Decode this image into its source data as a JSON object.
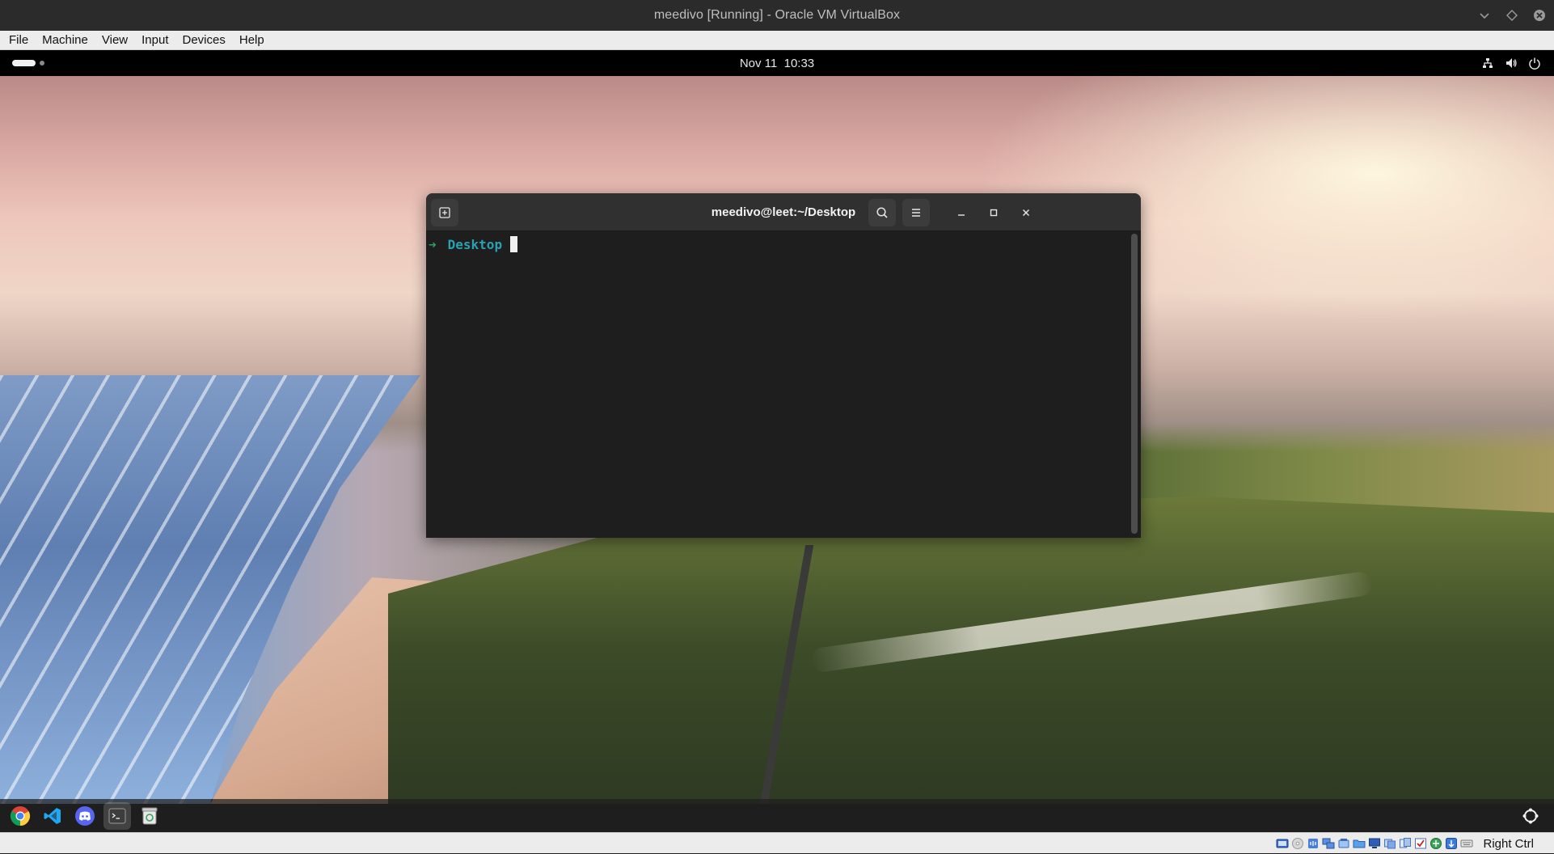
{
  "host_window": {
    "title": "meedivo [Running] - Oracle VM VirtualBox",
    "menu": [
      "File",
      "Machine",
      "View",
      "Input",
      "Devices",
      "Help"
    ],
    "statusbar": {
      "host_key": "Right Ctrl",
      "indicator_icons": [
        "hard-disk-icon",
        "optical-drive-icon",
        "audio-icon",
        "network-icon",
        "usb-icon",
        "shared-folders-icon",
        "display-icon",
        "video-capture-icon",
        "clipboard-icon",
        "drag-drop-icon",
        "cpu-icon",
        "mouse-integration-icon",
        "keyboard-icon"
      ]
    }
  },
  "guest": {
    "topbar": {
      "date": "Nov 11",
      "time": "10:33"
    },
    "terminal": {
      "title": "meedivo@leet:~/Desktop",
      "prompt_arrow": "➜",
      "prompt_dir": "Desktop"
    },
    "dock": {
      "apps": [
        "Google Chrome",
        "Visual Studio Code",
        "Discord",
        "Terminal",
        "Trash"
      ]
    }
  }
}
